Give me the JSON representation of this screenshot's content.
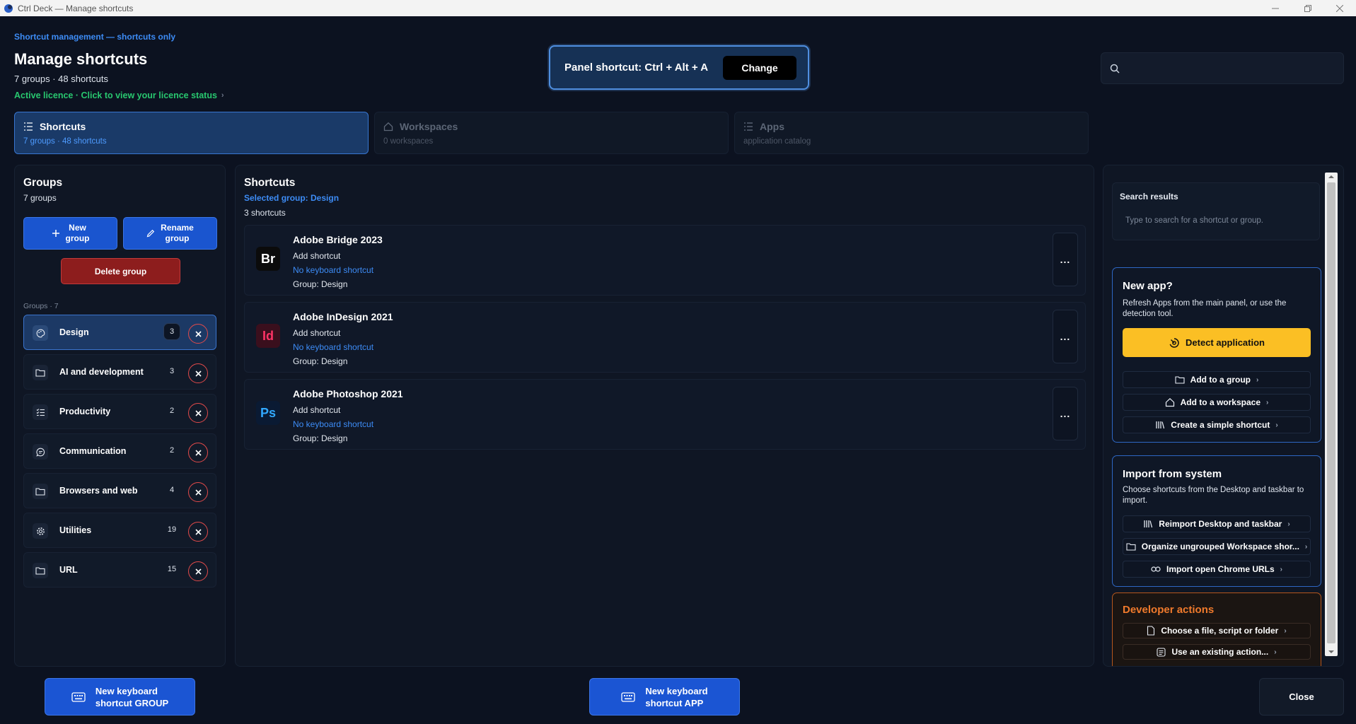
{
  "window": {
    "title": "Ctrl Deck — Manage shortcuts"
  },
  "header": {
    "kicker": "Shortcut management — shortcuts only",
    "title": "Manage shortcuts",
    "counts": "7 groups · 48 shortcuts",
    "licence": "Active licence · Click to view your licence status",
    "panel_shortcut": "Panel shortcut: Ctrl + Alt + A",
    "change_label": "Change",
    "search_placeholder": ""
  },
  "tabs": [
    {
      "label": "Shortcuts",
      "sub": "7 groups · 48 shortcuts",
      "icon": "list-icon",
      "active": true
    },
    {
      "label": "Workspaces",
      "sub": "0 workspaces",
      "icon": "home-icon",
      "active": false
    },
    {
      "label": "Apps",
      "sub": "application catalog",
      "icon": "list-icon",
      "active": false
    }
  ],
  "groups_panel": {
    "title": "Groups",
    "subtitle": "7 groups",
    "new_group_label_1": "New",
    "new_group_label_2": "group",
    "rename_group_label_1": "Rename",
    "rename_group_label_2": "group",
    "delete_group_label": "Delete group",
    "list_label": "Groups · 7",
    "items": [
      {
        "name": "Design",
        "count": "3",
        "icon": "palette-icon",
        "selected": true
      },
      {
        "name": "AI and development",
        "count": "3",
        "icon": "folder-icon",
        "selected": false
      },
      {
        "name": "Productivity",
        "count": "2",
        "icon": "checklist-icon",
        "selected": false
      },
      {
        "name": "Communication",
        "count": "2",
        "icon": "chat-icon",
        "selected": false
      },
      {
        "name": "Browsers and web",
        "count": "4",
        "icon": "folder-icon",
        "selected": false
      },
      {
        "name": "Utilities",
        "count": "19",
        "icon": "gear-icon",
        "selected": false
      },
      {
        "name": "URL",
        "count": "15",
        "icon": "folder-icon",
        "selected": false
      }
    ]
  },
  "shortcuts_panel": {
    "title": "Shortcuts",
    "selected_group": "Selected group: Design",
    "count": "3 shortcuts",
    "items": [
      {
        "name": "Adobe Bridge 2023",
        "abbr": "Br",
        "line1": "Add shortcut",
        "line2": "No keyboard shortcut",
        "line3": "Group: Design",
        "icon_bg": "#0b0b0b",
        "icon_fg": "#ffffff",
        "more": "..."
      },
      {
        "name": "Adobe InDesign 2021",
        "abbr": "Id",
        "line1": "Add shortcut",
        "line2": "No keyboard shortcut",
        "line3": "Group: Design",
        "icon_bg": "#3a0f1d",
        "icon_fg": "#ff3366",
        "more": "..."
      },
      {
        "name": "Adobe Photoshop 2021",
        "abbr": "Ps",
        "line1": "Add shortcut",
        "line2": "No keyboard shortcut",
        "line3": "Group: Design",
        "icon_bg": "#0a1a33",
        "icon_fg": "#31a8ff",
        "more": "..."
      }
    ]
  },
  "right_panel": {
    "search_results_title": "Search results",
    "search_results_hint": "Type to search for a shortcut or group.",
    "new_app": {
      "title": "New app?",
      "desc": "Refresh Apps from the main panel, or use the detection tool.",
      "detect_label": "Detect application",
      "actions": [
        {
          "label": "Add to a group",
          "icon": "folder-icon"
        },
        {
          "label": "Add to a workspace",
          "icon": "home-icon"
        },
        {
          "label": "Create a simple shortcut",
          "icon": "library-icon"
        }
      ]
    },
    "import": {
      "title": "Import from system",
      "desc": "Choose shortcuts from the Desktop and taskbar to import.",
      "actions": [
        {
          "label": "Reimport Desktop and taskbar",
          "icon": "library-icon"
        },
        {
          "label": "Organize ungrouped Workspace shor...",
          "icon": "folder-icon"
        },
        {
          "label": "Import open Chrome URLs",
          "icon": "link-icon"
        }
      ]
    },
    "developer": {
      "title": "Developer actions",
      "actions": [
        {
          "label": "Choose a file, script or folder",
          "icon": "file-icon"
        },
        {
          "label": "Use an existing action...",
          "icon": "list-box-icon"
        }
      ]
    }
  },
  "footer": {
    "new_group_shortcut_1": "New keyboard",
    "new_group_shortcut_2": "shortcut GROUP",
    "new_app_shortcut_1": "New keyboard",
    "new_app_shortcut_2": "shortcut APP",
    "close_label": "Close"
  },
  "colors": {
    "accent_blue": "#1a55cf",
    "licence_green": "#28c76f",
    "detect_yellow": "#fbbf24",
    "developer_orange": "#f07a2c",
    "danger_red": "#e24a4a"
  }
}
